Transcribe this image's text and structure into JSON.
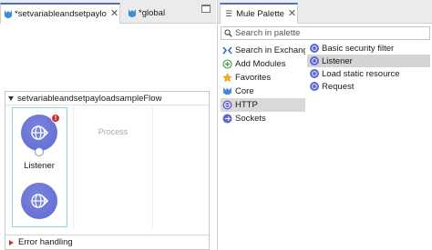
{
  "editor": {
    "tabs": [
      {
        "label": "*setvariableandsetpaylo",
        "active": true
      },
      {
        "label": "*global",
        "active": false
      }
    ],
    "close_glyph": "✕",
    "flow": {
      "name": "setvariableandsetpayloadsampleFlow",
      "process_label": "Process",
      "components": [
        {
          "label": "Listener",
          "icon": "globe-icon",
          "has_error": true,
          "error_glyph": "!"
        },
        {
          "label": "",
          "icon": "globe-icon",
          "has_error": false
        }
      ],
      "error_handling_label": "Error handling"
    }
  },
  "palette": {
    "tab_label": "Mule Palette",
    "close_glyph": "✕",
    "search_placeholder": "Search in palette",
    "categories": [
      {
        "label": "Search in Exchange...",
        "icon": "exchange-icon",
        "selected": false
      },
      {
        "label": "Add Modules",
        "icon": "add-icon",
        "selected": false
      },
      {
        "label": "Favorites",
        "icon": "star-icon",
        "selected": false
      },
      {
        "label": "Core",
        "icon": "mule-icon",
        "selected": false
      },
      {
        "label": "HTTP",
        "icon": "http-globe-icon",
        "selected": true
      },
      {
        "label": "Sockets",
        "icon": "sockets-icon",
        "selected": false
      }
    ],
    "operations": [
      {
        "label": "Basic security filter",
        "selected": false
      },
      {
        "label": "Listener",
        "selected": true
      },
      {
        "label": "Load static resource",
        "selected": false
      },
      {
        "label": "Request",
        "selected": false
      }
    ]
  },
  "colors": {
    "accent": "#4b6fc6",
    "component": "#5f68d0",
    "error": "#d32f2f",
    "selection_border": "#8fd4e0"
  }
}
